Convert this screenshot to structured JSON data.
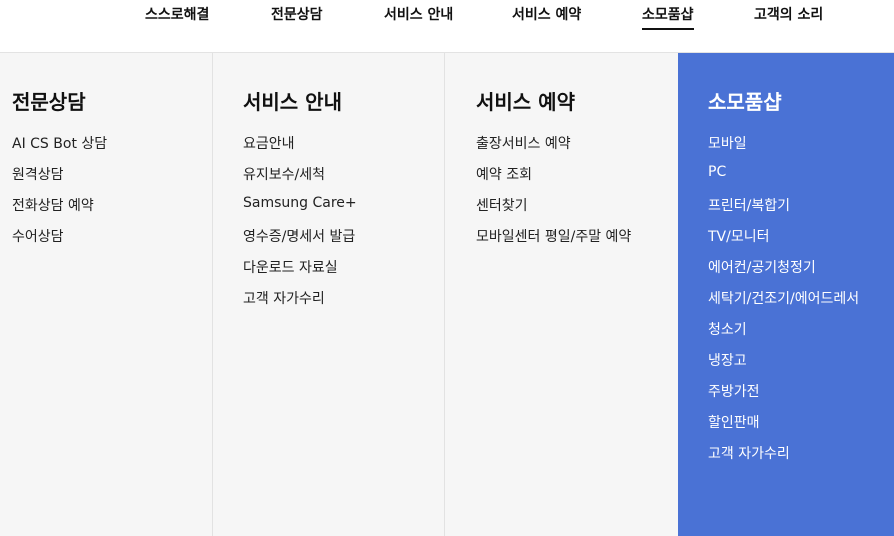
{
  "top_nav": {
    "items": [
      {
        "label": "스스로해결"
      },
      {
        "label": "전문상담"
      },
      {
        "label": "서비스 안내"
      },
      {
        "label": "서비스 예약"
      },
      {
        "label": "소모품샵"
      },
      {
        "label": "고객의 소리"
      }
    ],
    "active_item": "소모품샵"
  },
  "panels": [
    {
      "title": "전문상담",
      "items": [
        "AI CS Bot 상담",
        "원격상담",
        "전화상담 예약",
        "수어상담"
      ]
    },
    {
      "title": "서비스 안내",
      "items": [
        "요금안내",
        "유지보수/세척",
        "Samsung Care+",
        "영수증/명세서 발급",
        "다운로드 자료실",
        "고객 자가수리"
      ]
    },
    {
      "title": "서비스 예약",
      "items": [
        "출장서비스 예약",
        "예약 조회",
        "센터찾기",
        "모바일센터 평일/주말 예약"
      ]
    },
    {
      "title": "소모품샵",
      "items": [
        "모바일",
        "PC",
        "프린터/복합기",
        "TV/모니터",
        "에어컨/공기청정기",
        "세탁기/건조기/에어드레서",
        "청소기",
        "냉장고",
        "주방가전",
        "할인판매",
        "고객 자가수리"
      ]
    }
  ],
  "colors": {
    "highlight_panel": "#4a72d5",
    "panel_background": "#f6f6f6",
    "text": "#111111"
  }
}
